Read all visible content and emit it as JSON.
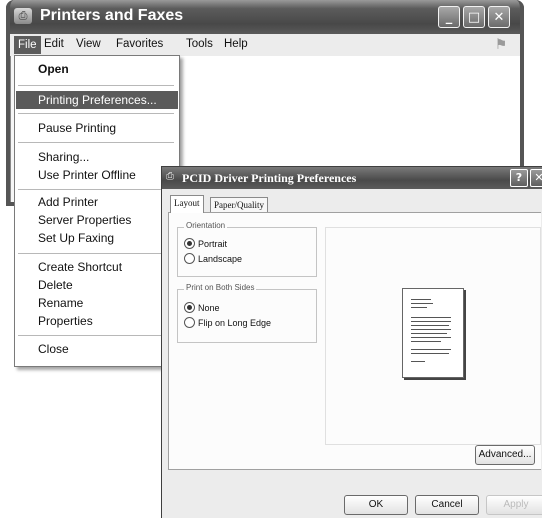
{
  "window": {
    "title": "Printers and Faxes",
    "title_icon": "printer-icon",
    "controls": [
      "_",
      "□",
      "✕"
    ],
    "menu": [
      "File",
      "Edit",
      "View",
      "Favorites",
      "Tools",
      "Help"
    ]
  },
  "file_menu": {
    "items": [
      {
        "label": "Open",
        "bold": true
      },
      {
        "label": "Printing Preferences...",
        "highlighted": true
      },
      {
        "label": "Pause Printing"
      },
      {
        "label": "Sharing..."
      },
      {
        "label": "Use Printer Offline"
      },
      {
        "label": "Add Printer"
      },
      {
        "label": "Server Properties"
      },
      {
        "label": "Set Up Faxing"
      },
      {
        "label": "Create Shortcut"
      },
      {
        "label": "Delete"
      },
      {
        "label": "Rename"
      },
      {
        "label": "Properties"
      },
      {
        "label": "Close"
      }
    ]
  },
  "dialog": {
    "title": "PCID Driver Printing Preferences",
    "help_label": "?",
    "close_label": "✕",
    "tabs": [
      "Layout",
      "Paper/Quality"
    ],
    "selected_tab": "Layout",
    "orientation": {
      "label": "Orientation",
      "options": [
        "Portrait",
        "Landscape"
      ],
      "selected": "Portrait"
    },
    "print_both_sides": {
      "label": "Print on Both Sides",
      "options": [
        "None",
        "Flip on Long Edge"
      ],
      "selected": "None"
    },
    "advanced_label": "Advanced...",
    "buttons": {
      "ok": "OK",
      "cancel": "Cancel",
      "apply": "Apply"
    }
  },
  "colors": {
    "titlebar": "#4a4a4a",
    "menu_highlight": "#5a5a5a"
  }
}
